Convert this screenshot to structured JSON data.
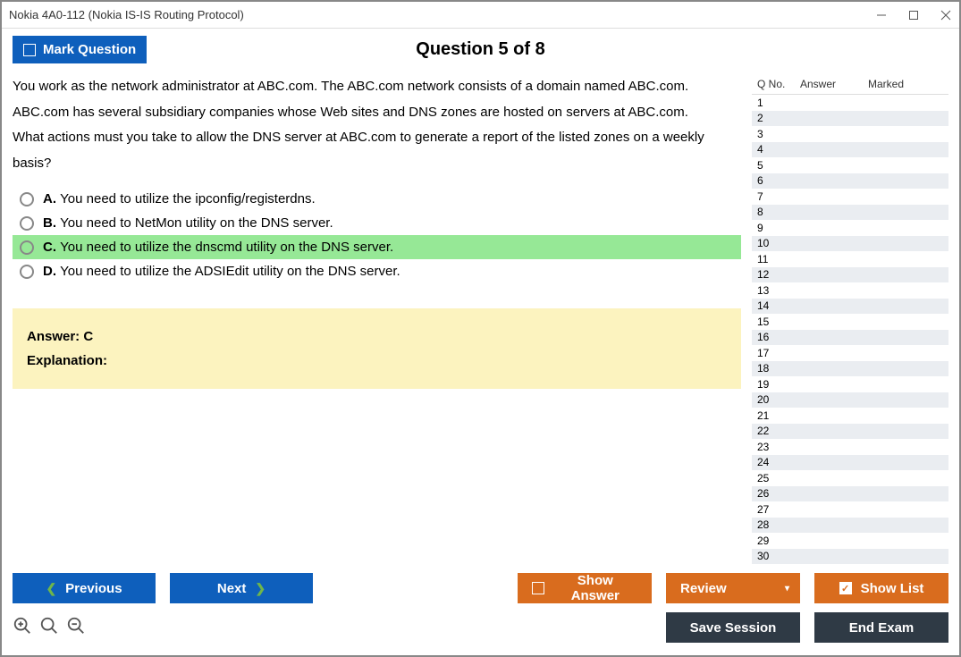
{
  "window": {
    "title": "Nokia 4A0-112 (Nokia IS-IS Routing Protocol)"
  },
  "header": {
    "mark_label": "Mark Question",
    "question_header": "Question 5 of 8"
  },
  "question": {
    "line1": "You work as the network administrator at ABC.com. The ABC.com network consists of a domain named ABC.com.",
    "line2": "ABC.com has several subsidiary companies whose Web sites and DNS zones are hosted on servers at ABC.com.",
    "line3": "What actions must you take to allow the DNS server at ABC.com to generate a report of the listed zones on a weekly basis?"
  },
  "options": [
    {
      "letter": "A.",
      "text": "You need to utilize the ipconfig/registerdns.",
      "correct": false
    },
    {
      "letter": "B.",
      "text": "You need to NetMon utility on the DNS server.",
      "correct": false
    },
    {
      "letter": "C.",
      "text": "You need to utilize the dnscmd utility on the DNS server.",
      "correct": true
    },
    {
      "letter": "D.",
      "text": "You need to utilize the ADSIEdit utility on the DNS server.",
      "correct": false
    }
  ],
  "answer_box": {
    "answer_label": "Answer: C",
    "explanation_label": "Explanation:"
  },
  "side": {
    "col_qno": "Q No.",
    "col_answer": "Answer",
    "col_marked": "Marked",
    "rows": 30
  },
  "footer": {
    "previous": "Previous",
    "next": "Next",
    "show_answer": "Show Answer",
    "review": "Review",
    "show_list": "Show List",
    "save_session": "Save Session",
    "end_exam": "End Exam"
  }
}
